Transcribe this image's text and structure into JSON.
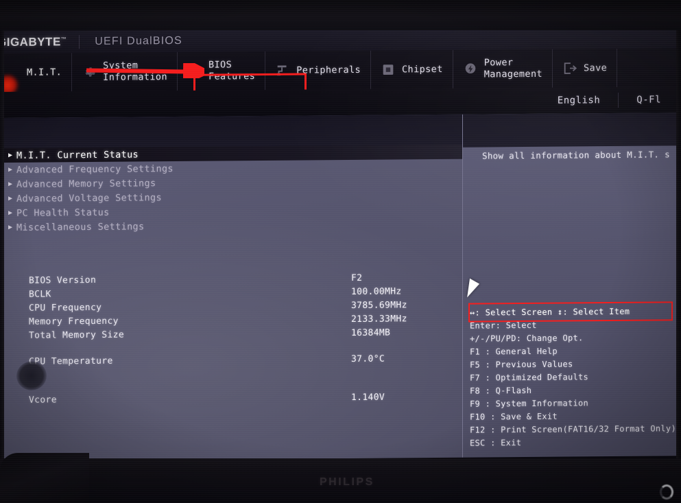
{
  "monitor": {
    "brand": "PHILIPS",
    "power_led": "power-led-indicator"
  },
  "brandbar": {
    "vendor": "GIGABYTE",
    "trademark": "™",
    "firmware": "UEFI DualBIOS"
  },
  "nav": {
    "tabs": [
      {
        "label": "M.I.T.",
        "icon": "mit-icon",
        "active": true
      },
      {
        "label": "System\nInformation",
        "icon": "gear-icon",
        "active": false
      },
      {
        "label": "BIOS\nFeatures",
        "icon": "chip-plus-icon",
        "active": false,
        "highlighted": true
      },
      {
        "label": "Peripherals",
        "icon": "plug-icon",
        "active": false
      },
      {
        "label": "Chipset",
        "icon": "chipset-icon",
        "active": false
      },
      {
        "label": "Power\nManagement",
        "icon": "lightning-icon",
        "active": false
      },
      {
        "label": "Save",
        "icon": "exit-arrow-icon",
        "active": false
      }
    ],
    "highlight_color": "#f51d1d"
  },
  "subbar": {
    "items": [
      {
        "label": "English",
        "name": "language-selector"
      },
      {
        "label": "Q-Fl",
        "name": "q-flash-button"
      }
    ]
  },
  "menu": {
    "items": [
      {
        "label": "M.I.T. Current Status",
        "selected": true
      },
      {
        "label": "Advanced Frequency Settings",
        "selected": false
      },
      {
        "label": "Advanced Memory Settings",
        "selected": false
      },
      {
        "label": "Advanced Voltage Settings",
        "selected": false
      },
      {
        "label": "PC Health Status",
        "selected": false
      },
      {
        "label": "Miscellaneous Settings",
        "selected": false
      }
    ],
    "caret": "▶"
  },
  "info": {
    "rows": [
      {
        "key": "BIOS Version",
        "value": "F2"
      },
      {
        "key": "BCLK",
        "value": "100.00MHz"
      },
      {
        "key": "CPU Frequency",
        "value": "3785.69MHz"
      },
      {
        "key": "Memory Frequency",
        "value": "2133.33MHz"
      },
      {
        "key": "Total Memory Size",
        "value": "16384MB"
      }
    ],
    "rows2": [
      {
        "key": "CPU Temperature",
        "value": "37.0°C"
      }
    ],
    "rows3": [
      {
        "key": "Vcore",
        "value": "1.140V"
      }
    ]
  },
  "help": {
    "text": "Show all information about M.I.T. s"
  },
  "legend": {
    "rows": [
      "↔: Select Screen   ↕: Select Item",
      "Enter: Select",
      "+/-/PU/PD: Change Opt.",
      "F1  : General Help",
      "F5  : Previous Values",
      "F7  : Optimized Defaults",
      "F8  : Q-Flash",
      "F9  : System Information",
      "F10 : Save & Exit",
      "F12 : Print Screen(FAT16/32 Format Only)",
      "ESC : Exit"
    ],
    "box_color": "#f51d1d"
  },
  "annotation": {
    "arrow_color": "#f51d1d",
    "arrow_name": "red-pointer-arrow"
  }
}
